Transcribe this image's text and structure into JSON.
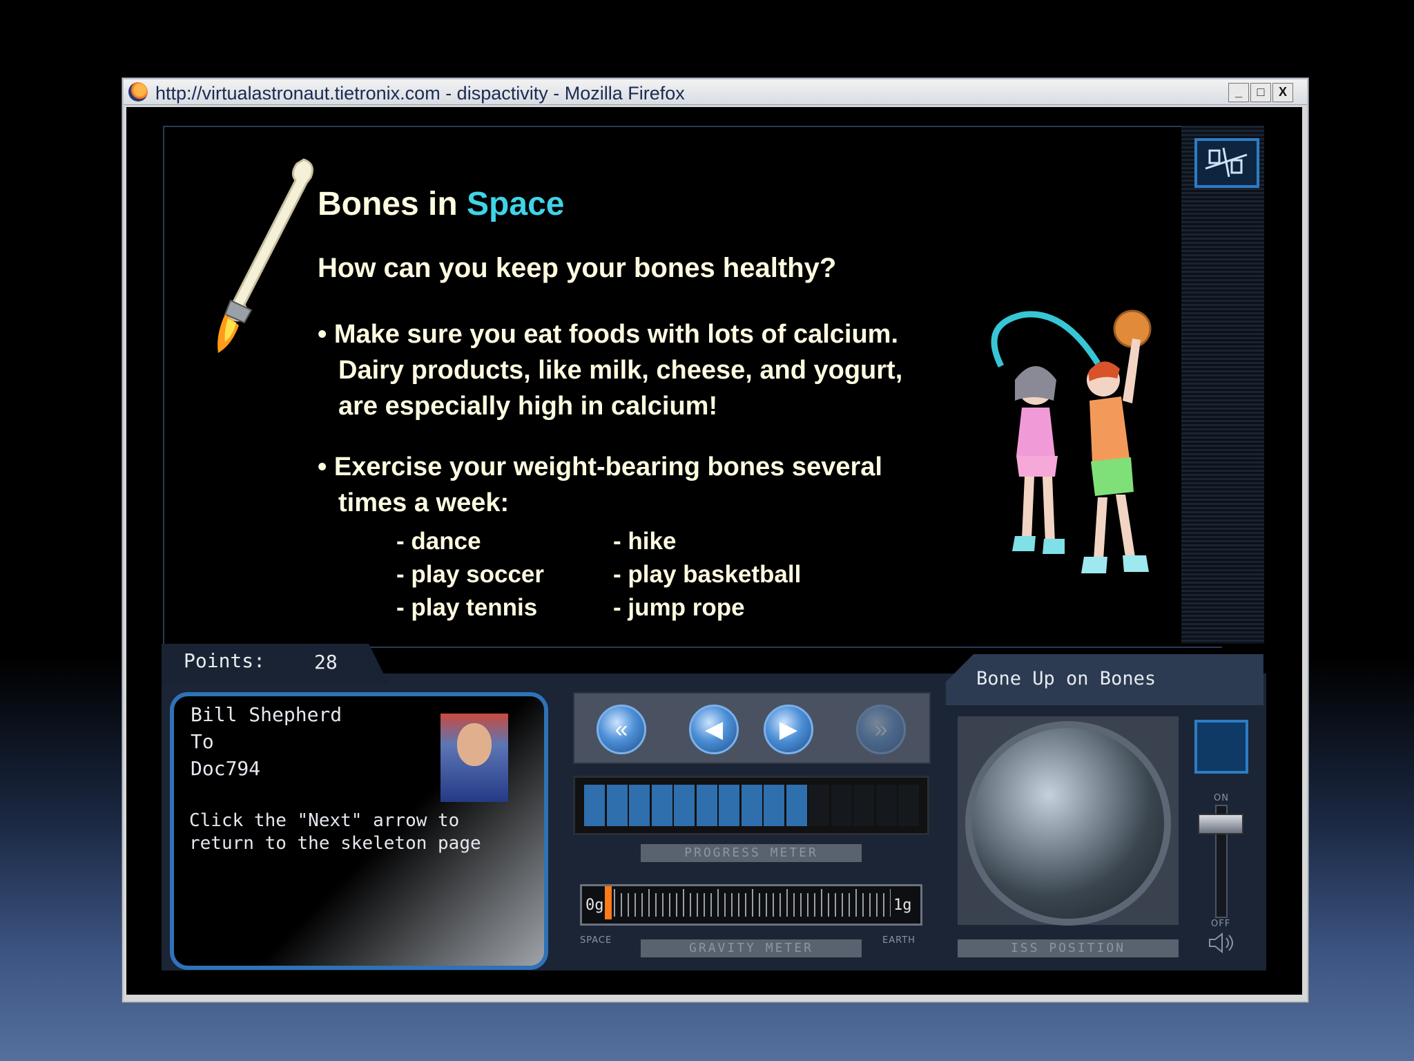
{
  "window": {
    "title": "http://virtualastronaut.tietronix.com - dispactivity - Mozilla Firefox",
    "controls": [
      "_",
      "□",
      "X"
    ]
  },
  "lesson": {
    "heading_a": "Bones in",
    "heading_b": "Space",
    "question": "How can you keep your bones healthy?",
    "bullet1_lines": [
      "• Make sure you eat foods with lots of calcium.",
      "Dairy products, like milk, cheese, and yogurt,",
      "are especially high in calcium!"
    ],
    "bullet2_lines": [
      "• Exercise your weight-bearing bones several",
      "times a week:"
    ],
    "activities_left": [
      "- dance",
      "- play soccer",
      "- play tennis"
    ],
    "activities_right": [
      "- hike",
      "- play basketball",
      "- jump rope"
    ]
  },
  "points": {
    "label": "Points:",
    "value": "28"
  },
  "message": {
    "from": "Bill Shepherd",
    "to_label": "To",
    "to": "Doc794",
    "text_lines": [
      "Click the \"Next\" arrow to",
      "return to the skeleton page"
    ]
  },
  "nav": {
    "buttons": [
      "first",
      "previous",
      "next",
      "last"
    ],
    "progress": {
      "label": "PROGRESS METER",
      "filled": 10,
      "total": 15
    }
  },
  "gravity": {
    "label": "GRAVITY METER",
    "min": "0g",
    "max": "1g",
    "left_caption": "SPACE",
    "right_caption": "EARTH"
  },
  "module": {
    "title": "Bone Up on Bones"
  },
  "iss": {
    "label": "ISS POSITION"
  },
  "volume": {
    "on_label": "ON",
    "off_label": "OFF"
  }
}
